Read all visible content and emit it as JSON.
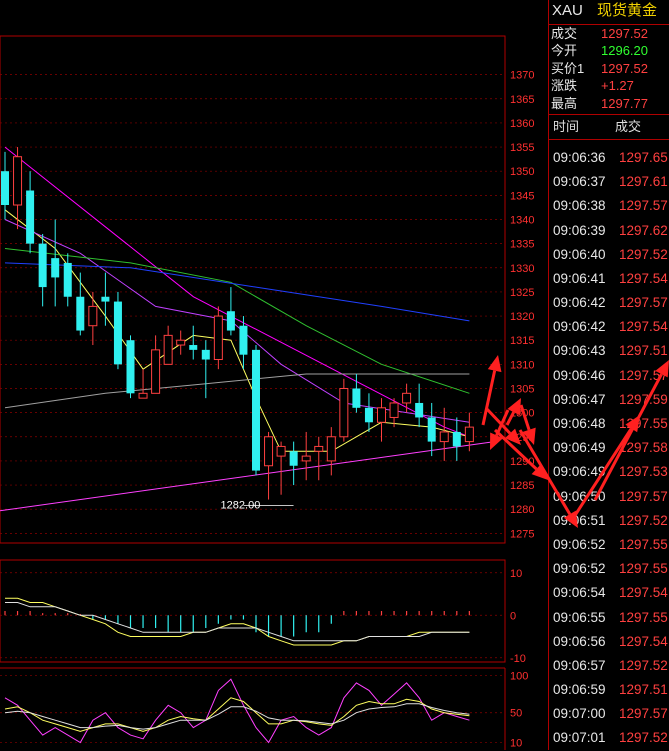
{
  "header": {
    "symbol": "XAU",
    "name": "现货黄金"
  },
  "quote": [
    {
      "label": "成交",
      "value": "1297.52",
      "color": "#ff4040"
    },
    {
      "label": "今开",
      "value": "1296.20",
      "color": "#30ff30"
    },
    {
      "label": "买价1",
      "value": "1297.52",
      "color": "#ff4040"
    },
    {
      "label": "涨跌",
      "value": "+1.27",
      "color": "#ff4040"
    },
    {
      "label": "最高",
      "value": "1297.77",
      "color": "#ff4040"
    }
  ],
  "ticks_header": {
    "time": "时间",
    "price": "成交"
  },
  "ticks": [
    {
      "time": "09:06:36",
      "price": "1297.65"
    },
    {
      "time": "09:06:37",
      "price": "1297.61"
    },
    {
      "time": "09:06:38",
      "price": "1297.57"
    },
    {
      "time": "09:06:39",
      "price": "1297.62"
    },
    {
      "time": "09:06:40",
      "price": "1297.52"
    },
    {
      "time": "09:06:41",
      "price": "1297.54"
    },
    {
      "time": "09:06:42",
      "price": "1297.57"
    },
    {
      "time": "09:06:42",
      "price": "1297.54"
    },
    {
      "time": "09:06:43",
      "price": "1297.51"
    },
    {
      "time": "09:06:46",
      "price": "1297.57"
    },
    {
      "time": "09:06:47",
      "price": "1297.59"
    },
    {
      "time": "09:06:48",
      "price": "1297.55"
    },
    {
      "time": "09:06:49",
      "price": "1297.58"
    },
    {
      "time": "09:06:49",
      "price": "1297.53"
    },
    {
      "time": "09:06:50",
      "price": "1297.57"
    },
    {
      "time": "09:06:51",
      "price": "1297.52"
    },
    {
      "time": "09:06:52",
      "price": "1297.55"
    },
    {
      "time": "09:06:52",
      "price": "1297.55"
    },
    {
      "time": "09:06:54",
      "price": "1297.54"
    },
    {
      "time": "09:06:55",
      "price": "1297.55"
    },
    {
      "time": "09:06:56",
      "price": "1297.54"
    },
    {
      "time": "09:06:57",
      "price": "1297.52"
    },
    {
      "time": "09:06:59",
      "price": "1297.51"
    },
    {
      "time": "09:07:00",
      "price": "1297.57"
    },
    {
      "time": "09:07:01",
      "price": "1297.52"
    }
  ],
  "chart_data": {
    "type": "candlestick",
    "yticks": [
      1370,
      1365,
      1360,
      1355,
      1350,
      1345,
      1340,
      1335,
      1330,
      1325,
      1320,
      1315,
      1310,
      1305,
      1300,
      1295,
      1290,
      1285,
      1280,
      1275
    ],
    "ylim": [
      1273,
      1378
    ],
    "low_annotation": {
      "text": "1282.00",
      "value": 1282.0
    },
    "up_color": "#ff4040",
    "down_color": "#30f0f0",
    "candles": [
      {
        "o": 1350,
        "h": 1354,
        "l": 1340,
        "c": 1343
      },
      {
        "o": 1343,
        "h": 1355,
        "l": 1338,
        "c": 1353
      },
      {
        "o": 1346,
        "h": 1350,
        "l": 1333,
        "c": 1335
      },
      {
        "o": 1335,
        "h": 1337,
        "l": 1322,
        "c": 1326
      },
      {
        "o": 1332,
        "h": 1340,
        "l": 1322,
        "c": 1328
      },
      {
        "o": 1331,
        "h": 1333,
        "l": 1322,
        "c": 1324
      },
      {
        "o": 1324,
        "h": 1329,
        "l": 1316,
        "c": 1317
      },
      {
        "o": 1318,
        "h": 1325,
        "l": 1314,
        "c": 1322
      },
      {
        "o": 1324,
        "h": 1329,
        "l": 1318,
        "c": 1323
      },
      {
        "o": 1323,
        "h": 1325,
        "l": 1309,
        "c": 1310
      },
      {
        "o": 1315,
        "h": 1316,
        "l": 1303,
        "c": 1304
      },
      {
        "o": 1303,
        "h": 1309,
        "l": 1303,
        "c": 1304
      },
      {
        "o": 1304,
        "h": 1316,
        "l": 1304,
        "c": 1313
      },
      {
        "o": 1310,
        "h": 1318,
        "l": 1310,
        "c": 1316
      },
      {
        "o": 1314,
        "h": 1317,
        "l": 1312,
        "c": 1315
      },
      {
        "o": 1314,
        "h": 1318,
        "l": 1311,
        "c": 1313
      },
      {
        "o": 1313,
        "h": 1315,
        "l": 1303,
        "c": 1311
      },
      {
        "o": 1311,
        "h": 1322,
        "l": 1309,
        "c": 1320
      },
      {
        "o": 1321,
        "h": 1326,
        "l": 1316,
        "c": 1317
      },
      {
        "o": 1318,
        "h": 1320,
        "l": 1309,
        "c": 1312
      },
      {
        "o": 1313,
        "h": 1314,
        "l": 1287,
        "c": 1288
      },
      {
        "o": 1289,
        "h": 1296,
        "l": 1282,
        "c": 1295
      },
      {
        "o": 1291,
        "h": 1294,
        "l": 1283,
        "c": 1293
      },
      {
        "o": 1292,
        "h": 1294,
        "l": 1285,
        "c": 1289
      },
      {
        "o": 1290,
        "h": 1296,
        "l": 1286,
        "c": 1291
      },
      {
        "o": 1292,
        "h": 1295,
        "l": 1286,
        "c": 1293
      },
      {
        "o": 1290,
        "h": 1297,
        "l": 1287,
        "c": 1295
      },
      {
        "o": 1295,
        "h": 1307,
        "l": 1294,
        "c": 1305
      },
      {
        "o": 1305,
        "h": 1308,
        "l": 1300,
        "c": 1301
      },
      {
        "o": 1301,
        "h": 1304,
        "l": 1296,
        "c": 1298
      },
      {
        "o": 1298,
        "h": 1303,
        "l": 1294,
        "c": 1301
      },
      {
        "o": 1299,
        "h": 1303,
        "l": 1297,
        "c": 1302
      },
      {
        "o": 1302,
        "h": 1306,
        "l": 1300,
        "c": 1304
      },
      {
        "o": 1302,
        "h": 1306,
        "l": 1297,
        "c": 1299
      },
      {
        "o": 1299,
        "h": 1302,
        "l": 1291,
        "c": 1294
      },
      {
        "o": 1294,
        "h": 1301,
        "l": 1290,
        "c": 1296
      },
      {
        "o": 1296,
        "h": 1299,
        "l": 1290,
        "c": 1293
      },
      {
        "o": 1294,
        "h": 1300,
        "l": 1292,
        "c": 1297
      }
    ],
    "moving_averages": [
      {
        "color": "#ff00ff",
        "points": [
          [
            0,
            1355
          ],
          [
            15,
            1324
          ],
          [
            35,
            1297
          ],
          [
            37,
            1295
          ]
        ]
      },
      {
        "color": "#ffff60",
        "points": [
          [
            0,
            1342
          ],
          [
            4,
            1334
          ],
          [
            8,
            1320
          ],
          [
            11,
            1309
          ],
          [
            15,
            1316
          ],
          [
            18,
            1315
          ],
          [
            20,
            1303
          ],
          [
            22,
            1292
          ],
          [
            26,
            1292
          ],
          [
            30,
            1298
          ],
          [
            34,
            1297
          ],
          [
            37,
            1295
          ]
        ]
      },
      {
        "color": "#c040ff",
        "points": [
          [
            0,
            1340
          ],
          [
            6,
            1333
          ],
          [
            12,
            1322
          ],
          [
            18,
            1319
          ],
          [
            22,
            1310
          ],
          [
            27,
            1302
          ],
          [
            32,
            1300
          ],
          [
            37,
            1298
          ]
        ]
      },
      {
        "color": "#30c030",
        "points": [
          [
            0,
            1334
          ],
          [
            10,
            1331
          ],
          [
            18,
            1327
          ],
          [
            24,
            1318
          ],
          [
            30,
            1310
          ],
          [
            37,
            1304
          ]
        ]
      },
      {
        "color": "#2040ff",
        "points": [
          [
            0,
            1331
          ],
          [
            10,
            1330
          ],
          [
            20,
            1326
          ],
          [
            30,
            1322
          ],
          [
            37,
            1319
          ]
        ]
      },
      {
        "color": "#a0a0a0",
        "points": [
          [
            0,
            1301
          ],
          [
            8,
            1304
          ],
          [
            16,
            1306
          ],
          [
            24,
            1308
          ],
          [
            37,
            1308
          ]
        ]
      }
    ],
    "trendline": {
      "color": "#ff40ff",
      "from": [
        -5,
        1278
      ],
      "to": [
        39,
        1294
      ]
    },
    "macd": {
      "yticks": [
        10,
        0,
        -10
      ],
      "ylim": [
        -11,
        13
      ],
      "histogram": [
        1,
        1,
        1,
        0.5,
        0.5,
        0.5,
        0.3,
        -1,
        -1,
        -2,
        -3,
        -3,
        -3,
        -4,
        -4,
        -4,
        -3,
        -2,
        -1,
        -1,
        -4,
        -5,
        -5,
        -5,
        -4,
        -4,
        -2,
        1,
        1,
        1,
        1,
        1,
        1,
        1,
        1,
        1,
        1,
        1
      ],
      "lines": [
        {
          "color": "#ffff60",
          "values": [
            4,
            4,
            3,
            3,
            2,
            1,
            0,
            -1,
            -2,
            -4,
            -5,
            -5,
            -5,
            -5,
            -5,
            -4,
            -4,
            -3,
            -2,
            -2,
            -3,
            -5,
            -6,
            -7,
            -7,
            -7,
            -7,
            -6,
            -6,
            -5,
            -5,
            -5,
            -5,
            -4,
            -4,
            -4,
            -4,
            -4
          ]
        },
        {
          "color": "#e0e0e0",
          "values": [
            3,
            3,
            2,
            2,
            2,
            1,
            0,
            0,
            -1,
            -2,
            -3,
            -4,
            -4,
            -4,
            -4,
            -4,
            -4,
            -3,
            -3,
            -3,
            -3,
            -4,
            -5,
            -6,
            -6,
            -6,
            -6,
            -6,
            -6,
            -5,
            -5,
            -5,
            -5,
            -5,
            -4,
            -4,
            -4,
            -4
          ]
        }
      ]
    },
    "stoch": {
      "yticks": [
        100,
        50,
        10
      ],
      "ylim": [
        0,
        110
      ],
      "lines": [
        {
          "color": "#ff40ff",
          "values": [
            70,
            60,
            40,
            20,
            30,
            20,
            10,
            40,
            50,
            30,
            20,
            15,
            40,
            60,
            50,
            30,
            40,
            80,
            95,
            60,
            30,
            10,
            40,
            45,
            30,
            20,
            30,
            70,
            90,
            80,
            60,
            75,
            90,
            70,
            40,
            50,
            45,
            40
          ]
        },
        {
          "color": "#ffff60",
          "values": [
            55,
            58,
            50,
            40,
            35,
            30,
            25,
            30,
            35,
            35,
            30,
            25,
            30,
            40,
            45,
            42,
            40,
            55,
            70,
            65,
            50,
            35,
            35,
            40,
            38,
            35,
            33,
            45,
            60,
            65,
            62,
            62,
            68,
            65,
            55,
            50,
            48,
            46
          ]
        },
        {
          "color": "#e0e0e0",
          "values": [
            50,
            52,
            50,
            45,
            40,
            35,
            30,
            30,
            32,
            33,
            30,
            28,
            30,
            35,
            40,
            40,
            40,
            48,
            58,
            58,
            52,
            43,
            40,
            40,
            39,
            37,
            35,
            40,
            50,
            55,
            57,
            58,
            62,
            62,
            57,
            53,
            50,
            48
          ]
        }
      ]
    },
    "arrows": [
      {
        "from": [
          483,
          425
        ],
        "to": [
          498,
          355
        ]
      },
      {
        "from": [
          486,
          408
        ],
        "to": [
          521,
          445
        ]
      },
      {
        "from": [
          507,
          425
        ],
        "to": [
          521,
          398
        ]
      },
      {
        "from": [
          521,
          405
        ],
        "to": [
          534,
          445
        ]
      },
      {
        "from": [
          508,
          410
        ],
        "to": [
          490,
          450
        ]
      },
      {
        "from": [
          495,
          430
        ],
        "to": [
          548,
          480
        ]
      },
      {
        "from": [
          520,
          430
        ],
        "to": [
          578,
          528
        ]
      },
      {
        "from": [
          572,
          520
        ],
        "to": [
          640,
          415
        ]
      },
      {
        "from": [
          595,
          500
        ],
        "to": [
          669,
          360
        ]
      }
    ]
  }
}
